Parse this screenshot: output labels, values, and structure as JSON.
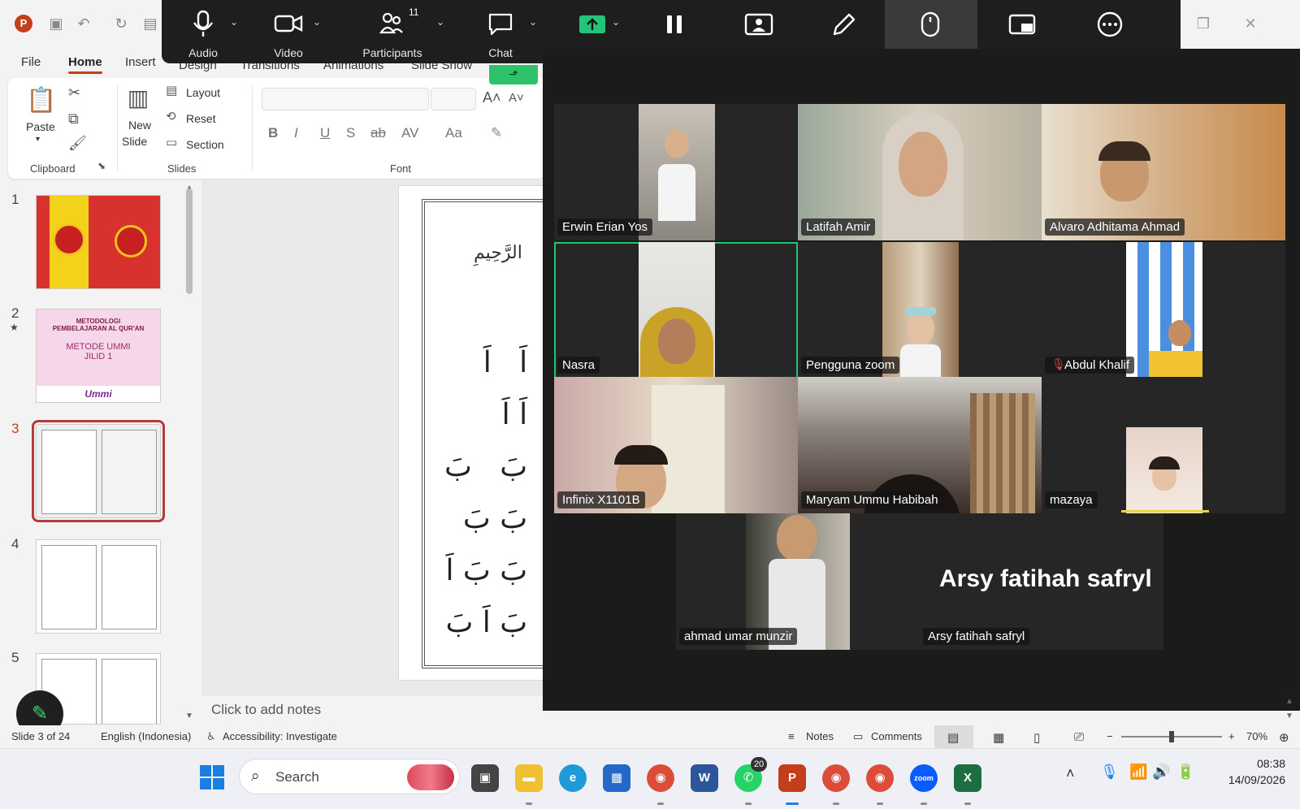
{
  "colors": {
    "ppt_accent": "#c43e1c",
    "zoom_toolbar_bg": "#1e1e1e",
    "zoom_window_bg": "#1b1b1b",
    "active_speaker": "#24c37a",
    "share_green": "#24c37a"
  },
  "ppt": {
    "tabs": [
      {
        "label": "File"
      },
      {
        "label": "Home"
      },
      {
        "label": "Insert"
      },
      {
        "label": "Design"
      },
      {
        "label": "Transitions"
      },
      {
        "label": "Animations"
      },
      {
        "label": "Slide Show"
      }
    ],
    "ribbon": {
      "paste": "Paste",
      "clipboard": "Clipboard",
      "new_slide_1": "New",
      "new_slide_2": "Slide",
      "layout": "Layout",
      "reset": "Reset",
      "section": "Section",
      "slides": "Slides",
      "font": "Font",
      "fmt": [
        "B",
        "I",
        "U",
        "S",
        "ab",
        "AV",
        "Aa"
      ]
    },
    "thumbs": [
      {
        "num": "1"
      },
      {
        "num": "2",
        "title_1": "METODOLOGI",
        "title_2": "PEMBELAJARAN AL QUR'AN",
        "line_1": "METODE UMMI",
        "line_2": "JILID 1",
        "brand": "Ummi"
      },
      {
        "num": "3"
      },
      {
        "num": "4"
      },
      {
        "num": "5"
      }
    ],
    "notes_placeholder": "Click to add notes"
  },
  "status": {
    "slide": "Slide 3 of 24",
    "language": "English (Indonesia)",
    "accessibility": "Accessibility: Investigate",
    "notes": "Notes",
    "comments": "Comments",
    "zoom_minus": "−",
    "zoom_plus": "+",
    "zoom": "70%",
    "zoom_fraction": 0.5
  },
  "zoom_toolbar": {
    "audio": "Audio",
    "video": "Video",
    "participants": "Participants",
    "participant_count": "11",
    "chat": "Chat"
  },
  "participants": [
    {
      "name": "Erwin Erian Yos",
      "icon": "none"
    },
    {
      "name": "Latifah Amir"
    },
    {
      "name": "Alvaro Adhitama Ahmad"
    },
    {
      "name": "Nasra"
    },
    {
      "name": "Pengguna zoom"
    },
    {
      "name": "Abdul Khalif",
      "icon": "muted-mic-icon"
    },
    {
      "name": "Infinix X1101B"
    },
    {
      "name": "Maryam Ummu Habibah"
    },
    {
      "name": "mazaya"
    },
    {
      "name": "ahmad umar munzir"
    },
    {
      "name": "Arsy fatihah safryl",
      "display_name": "Arsy fatihah safryl"
    }
  ],
  "taskbar": {
    "search_placeholder": "Search",
    "whatsapp_badge": "20",
    "time": "08:38",
    "date": "14/09/2026",
    "zoom_app": "zoom"
  }
}
